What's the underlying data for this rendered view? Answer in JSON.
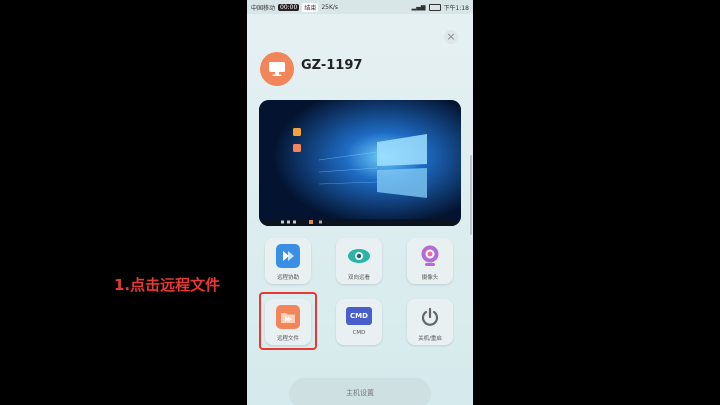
{
  "status_bar": {
    "carrier": "中国移动",
    "timer": "00:00",
    "tag": "结束",
    "speed": "25K/s",
    "battery": "",
    "time": "下午1:18"
  },
  "device": {
    "name": "GZ-1197"
  },
  "tiles": [
    {
      "label": "远程协助",
      "icon": "remote-assist-icon"
    },
    {
      "label": "双向远看",
      "icon": "eye-icon"
    },
    {
      "label": "摄像头",
      "icon": "camera-icon"
    },
    {
      "label": "远程文件",
      "icon": "remote-file-icon"
    },
    {
      "label": "CMD",
      "icon": "cmd-icon",
      "icon_text": "CMD"
    },
    {
      "label": "关机/重启",
      "icon": "power-icon"
    }
  ],
  "annotation": "1.点击远程文件",
  "bottom_button": "主机设置",
  "colors": {
    "accent_orange": "#f2855a",
    "highlight_red": "#e53935",
    "blue": "#3a8ee6",
    "purple": "#b36bd6"
  }
}
